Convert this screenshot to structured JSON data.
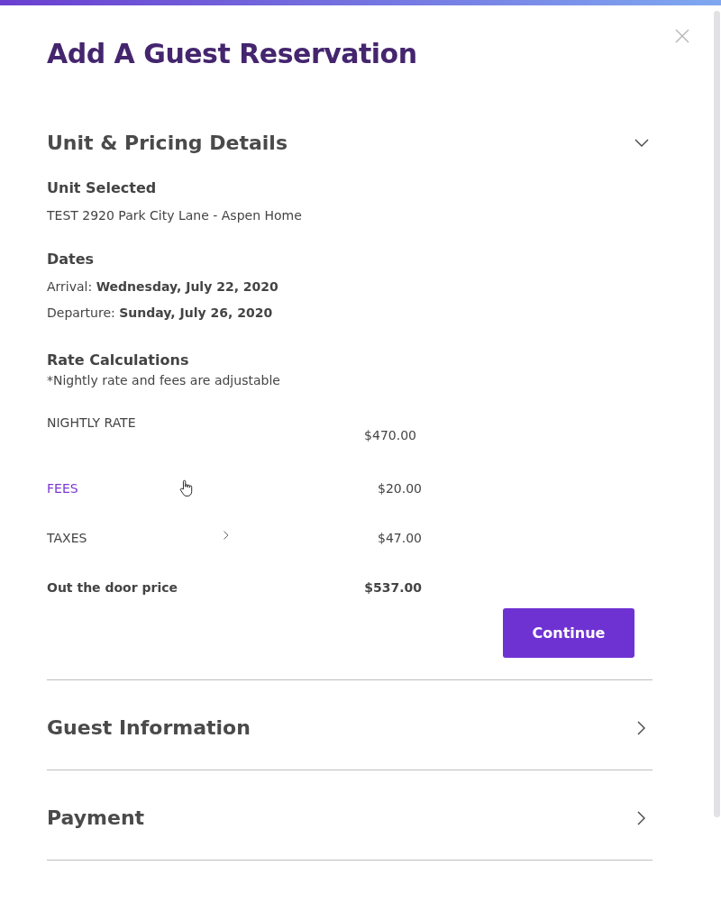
{
  "title": "Add A Guest Reservation",
  "sections": [
    {
      "heading": "Unit & Pricing Details",
      "expanded": true
    },
    {
      "heading": "Guest Information",
      "expanded": false
    },
    {
      "heading": "Payment",
      "expanded": false
    }
  ],
  "unit": {
    "heading": "Unit Selected",
    "value": "TEST 2920 Park City Lane - Aspen Home"
  },
  "dates": {
    "heading": "Dates",
    "lines": [
      "Arrival: **Wednesday, July 22, 2020**",
      "Departure: **Sunday, July 26, 2020**"
    ]
  },
  "rates": {
    "heading": "Rate Calculations",
    "note": "*Nightly rate and fees are adjustable",
    "items": [
      {
        "kind": "offset",
        "label": "NIGHTLY RATE",
        "amount": "$470.00"
      },
      {
        "kind": "link",
        "label": "FEES",
        "amount": "$20.00"
      },
      {
        "kind": "expandable",
        "label": "TAXES",
        "amount": "$47.00"
      },
      {
        "kind": "total",
        "label": "Out the door price",
        "amount": "$537.00"
      }
    ]
  },
  "continue_button": "Continue"
}
